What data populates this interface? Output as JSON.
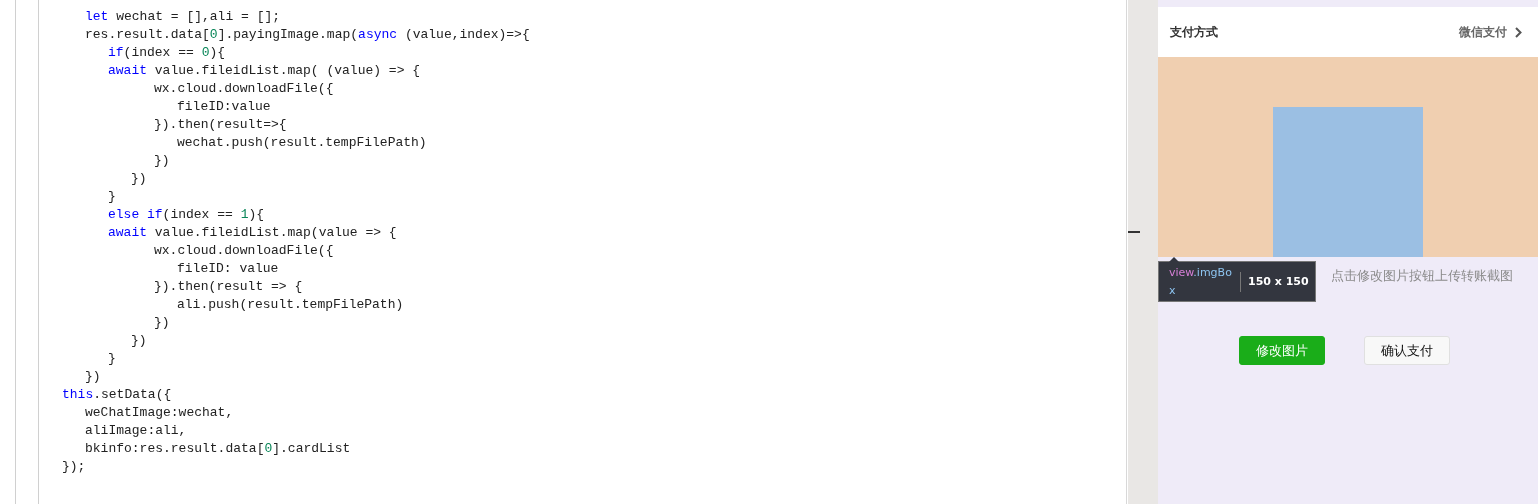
{
  "editor": {
    "lines": [
      {
        "tokens": [
          {
            "text": "\t\tlet",
            "kind": "keyword"
          },
          {
            "text": " wechat = [],ali = [];",
            "kind": "plain"
          }
        ]
      },
      {
        "tokens": [
          {
            "text": "\t\tres.result.data[",
            "kind": "plain"
          },
          {
            "text": "0",
            "kind": "number"
          },
          {
            "text": "].payingImage.map(",
            "kind": "plain"
          },
          {
            "text": "async",
            "kind": "keyword"
          },
          {
            "text": " (value,index)=>{",
            "kind": "plain"
          }
        ]
      },
      {
        "tokens": [
          {
            "text": "\t\t\tif",
            "kind": "keyword"
          },
          {
            "text": "(index == ",
            "kind": "plain"
          },
          {
            "text": "0",
            "kind": "number"
          },
          {
            "text": "){",
            "kind": "plain"
          }
        ]
      },
      {
        "tokens": [
          {
            "text": "\t\t\tawait",
            "kind": "keyword"
          },
          {
            "text": " value.fileidList.map( (value) => {",
            "kind": "plain"
          }
        ]
      },
      {
        "tokens": [
          {
            "text": "\t\t\t\t\twx.cloud.downloadFile({",
            "kind": "plain"
          }
        ]
      },
      {
        "tokens": [
          {
            "text": "\t\t\t\t\t\tfileID:value",
            "kind": "plain"
          }
        ]
      },
      {
        "tokens": [
          {
            "text": "\t\t\t\t\t}).then(result=>{",
            "kind": "plain"
          }
        ]
      },
      {
        "tokens": [
          {
            "text": "\t\t\t\t\t\twechat.push(result.tempFilePath)",
            "kind": "plain"
          }
        ]
      },
      {
        "tokens": [
          {
            "text": "\t\t\t\t\t})",
            "kind": "plain"
          }
        ]
      },
      {
        "tokens": [
          {
            "text": "\t\t\t\t})",
            "kind": "plain"
          }
        ]
      },
      {
        "tokens": [
          {
            "text": "\t\t\t}",
            "kind": "plain"
          }
        ]
      },
      {
        "tokens": [
          {
            "text": "\t\t\telse if",
            "kind": "keyword"
          },
          {
            "text": "(index == ",
            "kind": "plain"
          },
          {
            "text": "1",
            "kind": "number"
          },
          {
            "text": "){",
            "kind": "plain"
          }
        ]
      },
      {
        "tokens": [
          {
            "text": "\t\t\tawait",
            "kind": "keyword"
          },
          {
            "text": " value.fileidList.map(value => {",
            "kind": "plain"
          }
        ]
      },
      {
        "tokens": [
          {
            "text": "\t\t\t\t\twx.cloud.downloadFile({",
            "kind": "plain"
          }
        ]
      },
      {
        "tokens": [
          {
            "text": "\t\t\t\t\t\tfileID: value",
            "kind": "plain"
          }
        ]
      },
      {
        "tokens": [
          {
            "text": "\t\t\t\t\t}).then(result => {",
            "kind": "plain"
          }
        ]
      },
      {
        "tokens": [
          {
            "text": "\t\t\t\t\t\tali.push(result.tempFilePath)",
            "kind": "plain"
          }
        ]
      },
      {
        "tokens": [
          {
            "text": "\t\t\t\t\t})",
            "kind": "plain"
          }
        ]
      },
      {
        "tokens": [
          {
            "text": "\t\t\t\t})",
            "kind": "plain"
          }
        ]
      },
      {
        "tokens": [
          {
            "text": "\t\t\t}",
            "kind": "plain"
          }
        ]
      },
      {
        "tokens": [
          {
            "text": "\t\t})",
            "kind": "plain"
          }
        ]
      },
      {
        "tokens": [
          {
            "text": "\tthis",
            "kind": "keyword"
          },
          {
            "text": ".setData({",
            "kind": "plain"
          }
        ]
      },
      {
        "tokens": [
          {
            "text": "\t\tweChatImage:wechat,",
            "kind": "plain"
          }
        ]
      },
      {
        "tokens": [
          {
            "text": "\t\taliImage:ali,",
            "kind": "plain"
          }
        ]
      },
      {
        "tokens": [
          {
            "text": "\t\tbkinfo:res.result.data[",
            "kind": "plain"
          },
          {
            "text": "0",
            "kind": "number"
          },
          {
            "text": "].cardList",
            "kind": "plain"
          }
        ]
      },
      {
        "tokens": [
          {
            "text": "\t});",
            "kind": "plain"
          }
        ]
      }
    ]
  },
  "preview": {
    "payment_row": {
      "label": "支付方式",
      "value": "微信支付"
    },
    "hint": "点击修改图片按钮上传转账截图",
    "buttons": [
      {
        "label": "修改图片",
        "kind": "primary"
      },
      {
        "label": "确认支付",
        "kind": "default"
      }
    ],
    "inspector_tooltip": {
      "tag": "view",
      "class_name": ".imgBox",
      "size": "150 x 150"
    }
  }
}
